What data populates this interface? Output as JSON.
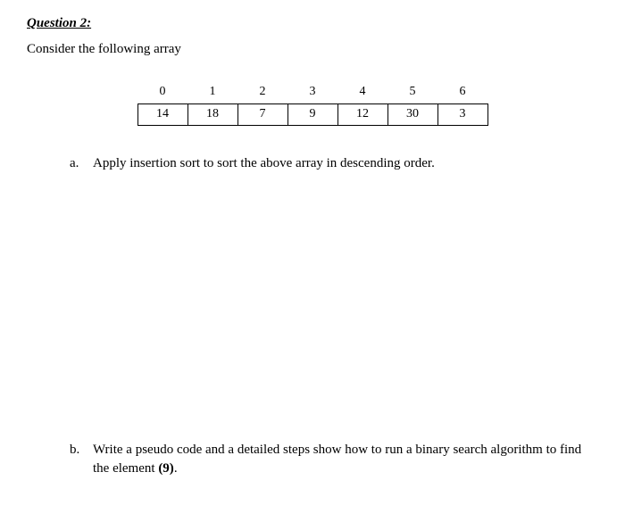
{
  "title": "Question 2:",
  "intro": "Consider the following array",
  "array": {
    "indices": [
      "0",
      "1",
      "2",
      "3",
      "4",
      "5",
      "6"
    ],
    "values": [
      "14",
      "18",
      "7",
      "9",
      "12",
      "30",
      "3"
    ]
  },
  "items": {
    "a": {
      "marker": "a.",
      "text": "Apply insertion sort to sort the above array in descending order."
    },
    "b": {
      "marker": "b.",
      "text_part1": "Write a pseudo code and a detailed steps show how to run a binary search algorithm to find the element ",
      "bold": "(9)",
      "text_part2": "."
    }
  }
}
